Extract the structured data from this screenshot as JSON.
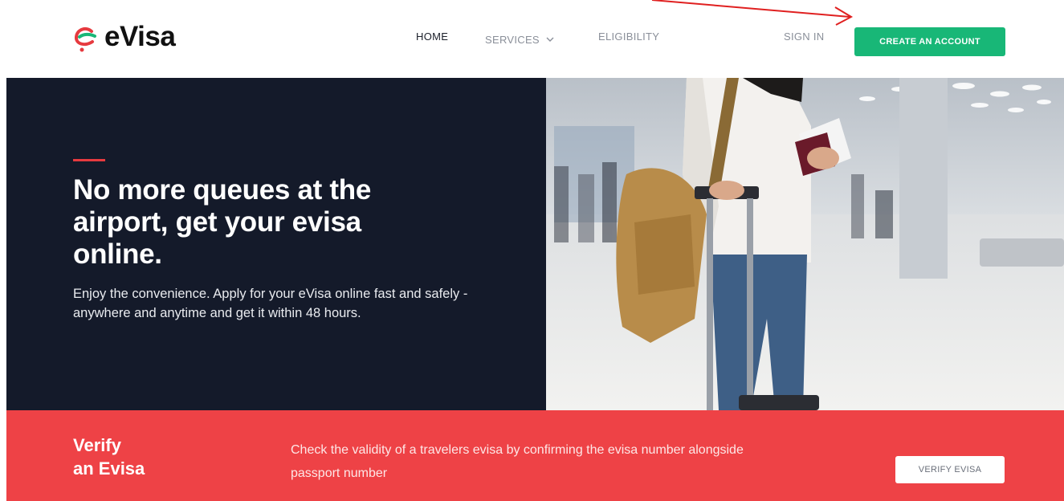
{
  "brand": {
    "name": "eVisa"
  },
  "nav": {
    "home": "HOME",
    "services": "SERVICES",
    "eligibility": "ELIGIBILITY",
    "sign_in": "SIGN IN",
    "create_account": "CREATE AN ACCOUNT"
  },
  "hero": {
    "title": "No more queues at the airport, get your evisa online.",
    "subtitle": "Enjoy the convenience. Apply for your eVisa online fast and safely - anywhere and anytime and get it within 48 hours."
  },
  "verify": {
    "title_line1": "Verify",
    "title_line2": "an Evisa",
    "description": "Check the validity of a travelers evisa by confirming the evisa number alongside passport number",
    "button": "VERIFY EVISA"
  },
  "colors": {
    "accent_green": "#18b777",
    "hero_bg": "#141a2a",
    "verify_red": "#ee4246",
    "accent_red": "#e63a3f"
  },
  "icons": {
    "logo": "evisa-logo-icon",
    "services_dropdown": "chevron-down-icon",
    "annotation": "red-arrow-icon"
  }
}
